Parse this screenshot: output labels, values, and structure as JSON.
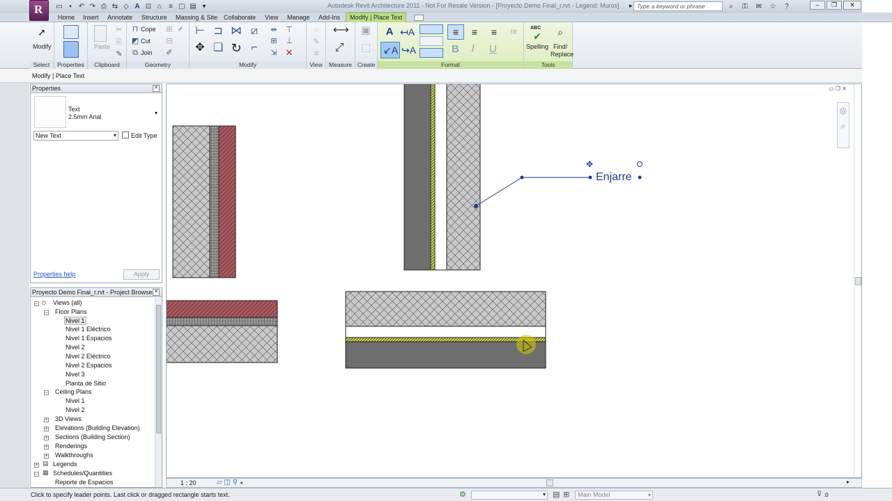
{
  "window": {
    "title": "Autodesk Revit Architecture 2011 - Not For Resale Version - [Proyecto Demo Final_r.rvt - Legend: Muros]",
    "search_placeholder": "Type a keyword or phrase",
    "app_letter": "R"
  },
  "ribbon_tabs": [
    "Home",
    "Insert",
    "Annotate",
    "Structure",
    "Massing & Site",
    "Collaborate",
    "View",
    "Manage",
    "Add-Ins",
    "Modify | Place Text"
  ],
  "ribbon": {
    "select": {
      "modify": "Modify",
      "label": "Select"
    },
    "properties": {
      "label": "Properties"
    },
    "clipboard": {
      "paste": "Paste",
      "label": "Clipboard"
    },
    "geometry": {
      "cope": "Cope",
      "cut": "Cut",
      "join": "Join",
      "label": "Geometry"
    },
    "modify": {
      "label": "Modify"
    },
    "view": {
      "label": "View"
    },
    "measure": {
      "label": "Measure"
    },
    "create": {
      "label": "Create"
    },
    "format": {
      "bold": "B",
      "italic": "I",
      "underline": "U",
      "label": "Format"
    },
    "tools": {
      "spelling": "Spelling",
      "find_replace_1": "Find/",
      "find_replace_2": "Replace",
      "abc": "ABC",
      "label": "Tools"
    }
  },
  "context_bar": "Modify | Place Text",
  "properties": {
    "title": "Properties",
    "type_name": "Text",
    "type_sub": "2.5mm Arial",
    "instance_dropdown": "New Text",
    "edit_type": "Edit Type",
    "help": "Properties help",
    "apply": "Apply"
  },
  "browser": {
    "title": "Proyecto Demo Final_r.rvt - Project Browser",
    "views_all": "Views (all)",
    "floor_plans": "Floor Plans",
    "floor_items": [
      "Nivel 1",
      "Nivel 1 Eléctrico",
      "Nivel 1 Espacios",
      "Nivel 2",
      "Nivel 2 Eléctrico",
      "Nivel 2 Espacios",
      "Nivel 3",
      "Planta de Sitio"
    ],
    "ceiling_plans": "Ceiling Plans",
    "ceiling_items": [
      "Nivel 1",
      "Nivel 2"
    ],
    "other": [
      "3D Views",
      "Elevations (Building Elevation)",
      "Sections (Building Section)",
      "Renderings",
      "Walkthroughs"
    ],
    "legends": "Legends",
    "schedules": "Schedules/Quantities",
    "schedule_item": "Reporte de Espacios"
  },
  "canvas": {
    "annotation": "Enjarre"
  },
  "view_bar": {
    "scale": "1 : 20"
  },
  "status": {
    "hint": "Click to specify leader points.  Last click or dragged rectangle starts text.",
    "model": "Main Model",
    "filter": ":0"
  },
  "colors": {
    "accent_green": "#bfe08a",
    "brick": "#a8585f",
    "concrete": "#6b6b6b",
    "annotation_blue": "#1f3a8a"
  }
}
